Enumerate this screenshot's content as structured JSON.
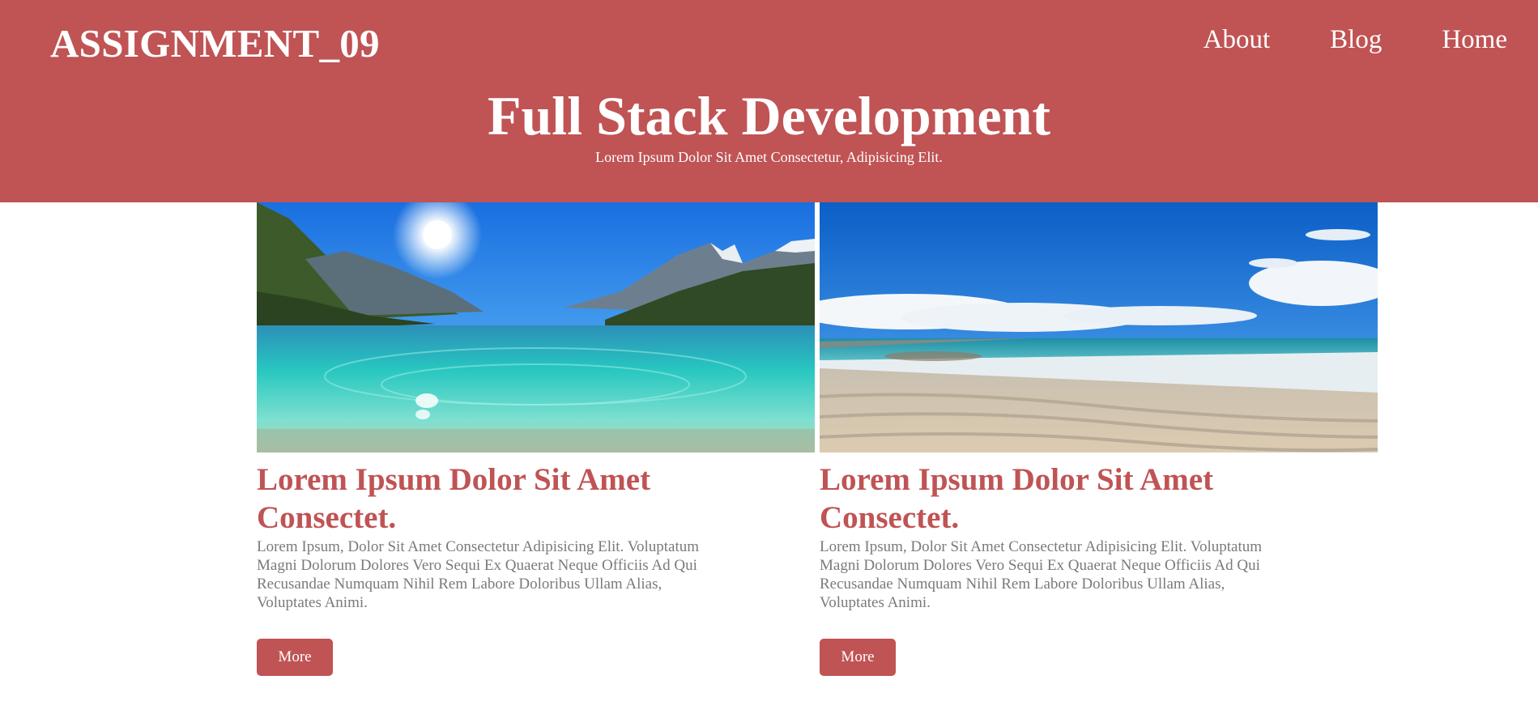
{
  "header": {
    "brand": "ASSIGNMENT_09",
    "nav": [
      {
        "label": "About"
      },
      {
        "label": "Blog"
      },
      {
        "label": "Home"
      }
    ],
    "hero_title": "Full Stack Development",
    "hero_subtitle": "Lorem Ipsum Dolor Sit Amet Consectetur, Adipisicing Elit."
  },
  "cards": [
    {
      "image": "lake-mountains-photo",
      "title": "Lorem Ipsum Dolor Sit Amet Consectet.",
      "text": "Lorem Ipsum, Dolor Sit Amet Consectetur Adipisicing Elit. Voluptatum Magni Dolorum Dolores Vero Sequi Ex Quaerat Neque Officiis Ad Qui Recusandae Numquam Nihil Rem Labore Doloribus Ullam Alias, Voluptates Animi.",
      "button": "More"
    },
    {
      "image": "beach-photo",
      "title": "Lorem Ipsum Dolor Sit Amet Consectet.",
      "text": "Lorem Ipsum, Dolor Sit Amet Consectetur Adipisicing Elit. Voluptatum Magni Dolorum Dolores Vero Sequi Ex Quaerat Neque Officiis Ad Qui Recusandae Numquam Nihil Rem Labore Doloribus Ullam Alias, Voluptates Animi.",
      "button": "More"
    }
  ],
  "colors": {
    "accent": "#c05354",
    "body_text": "#7a7a7a",
    "background": "#ffffff"
  }
}
